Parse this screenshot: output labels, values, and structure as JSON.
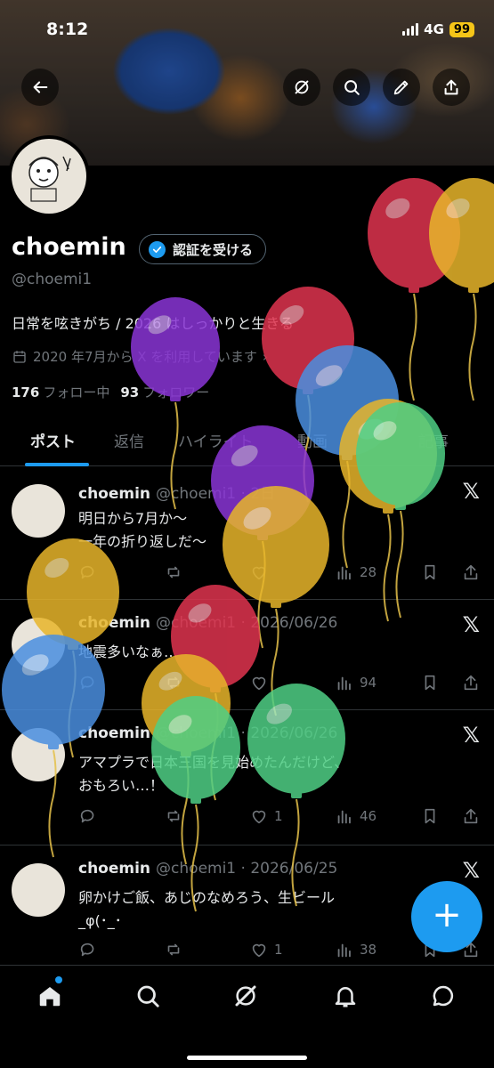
{
  "status_bar": {
    "time": "8:12",
    "network": "4G",
    "battery": "99"
  },
  "header": {
    "buttons": [
      "back-arrow",
      "grok",
      "search",
      "edit",
      "share"
    ]
  },
  "profile": {
    "name": "choemin",
    "verify_label": "認証を受ける",
    "handle": "@choemi1",
    "bio": "日常を呟きがち / 2026 はしっかりと生きる",
    "joined": "2020 年7月から X を利用しています",
    "following_count": "176",
    "following_label": "フォロー中",
    "followers_count": "93",
    "followers_label": "フォロワー"
  },
  "tabs": [
    "ポスト",
    "返信",
    "ハイライト",
    "動画",
    "記事"
  ],
  "posts": [
    {
      "name": "choemin",
      "meta": "@choemi1 · 2日",
      "text": "明日から7月か〜\n一年の折り返しだ〜",
      "likes": "",
      "views": "28"
    },
    {
      "name": "choemin",
      "meta": "@choemi1 · 2026/06/26",
      "text": "地震多いなぁ…",
      "likes": "",
      "views": "94"
    },
    {
      "name": "choemin",
      "meta": "@choemi1 · 2026/06/26",
      "text": "アマプラで日本三国を見始めたんだけど、\nおもろい…！",
      "likes": "1",
      "views": "46"
    },
    {
      "name": "choemin",
      "meta": "@choemi1 · 2026/06/25",
      "text": "卵かけご飯、あじのなめろう、生ビール\n_φ(･_･",
      "likes": "1",
      "views": "38"
    }
  ],
  "fab": {
    "label": "+"
  },
  "bottom_nav": [
    "home-icon",
    "search-icon",
    "grok-icon",
    "notifications-icon",
    "messages-icon"
  ],
  "colors": {
    "accent": "#1d9bf0",
    "balloons": [
      "#e0344f",
      "#e8b62b",
      "#8a35d6",
      "#4a8fe0",
      "#4fcf85"
    ]
  }
}
